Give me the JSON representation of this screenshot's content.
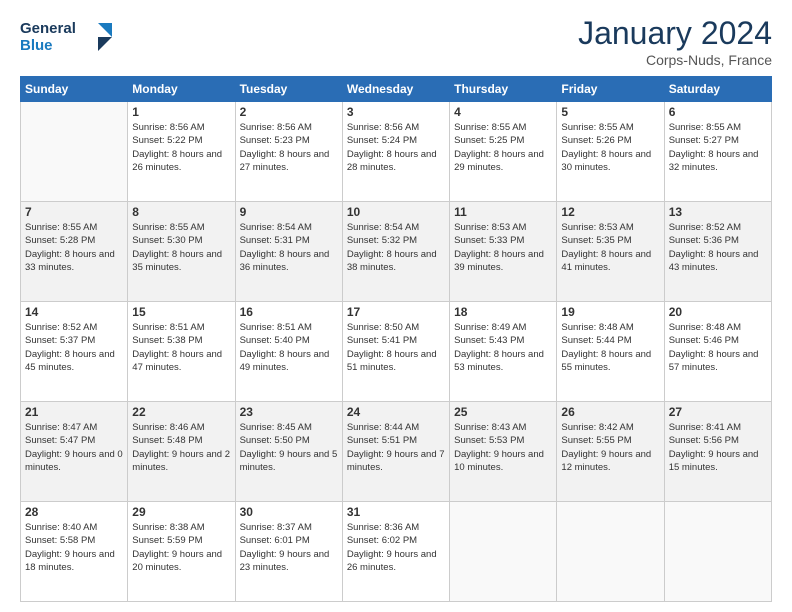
{
  "logo": {
    "line1": "General",
    "line2": "Blue"
  },
  "title": "January 2024",
  "location": "Corps-Nuds, France",
  "weekdays": [
    "Sunday",
    "Monday",
    "Tuesday",
    "Wednesday",
    "Thursday",
    "Friday",
    "Saturday"
  ],
  "weeks": [
    [
      {
        "day": "",
        "sunrise": "",
        "sunset": "",
        "daylight": ""
      },
      {
        "day": "1",
        "sunrise": "Sunrise: 8:56 AM",
        "sunset": "Sunset: 5:22 PM",
        "daylight": "Daylight: 8 hours and 26 minutes."
      },
      {
        "day": "2",
        "sunrise": "Sunrise: 8:56 AM",
        "sunset": "Sunset: 5:23 PM",
        "daylight": "Daylight: 8 hours and 27 minutes."
      },
      {
        "day": "3",
        "sunrise": "Sunrise: 8:56 AM",
        "sunset": "Sunset: 5:24 PM",
        "daylight": "Daylight: 8 hours and 28 minutes."
      },
      {
        "day": "4",
        "sunrise": "Sunrise: 8:55 AM",
        "sunset": "Sunset: 5:25 PM",
        "daylight": "Daylight: 8 hours and 29 minutes."
      },
      {
        "day": "5",
        "sunrise": "Sunrise: 8:55 AM",
        "sunset": "Sunset: 5:26 PM",
        "daylight": "Daylight: 8 hours and 30 minutes."
      },
      {
        "day": "6",
        "sunrise": "Sunrise: 8:55 AM",
        "sunset": "Sunset: 5:27 PM",
        "daylight": "Daylight: 8 hours and 32 minutes."
      }
    ],
    [
      {
        "day": "7",
        "sunrise": "Sunrise: 8:55 AM",
        "sunset": "Sunset: 5:28 PM",
        "daylight": "Daylight: 8 hours and 33 minutes."
      },
      {
        "day": "8",
        "sunrise": "Sunrise: 8:55 AM",
        "sunset": "Sunset: 5:30 PM",
        "daylight": "Daylight: 8 hours and 35 minutes."
      },
      {
        "day": "9",
        "sunrise": "Sunrise: 8:54 AM",
        "sunset": "Sunset: 5:31 PM",
        "daylight": "Daylight: 8 hours and 36 minutes."
      },
      {
        "day": "10",
        "sunrise": "Sunrise: 8:54 AM",
        "sunset": "Sunset: 5:32 PM",
        "daylight": "Daylight: 8 hours and 38 minutes."
      },
      {
        "day": "11",
        "sunrise": "Sunrise: 8:53 AM",
        "sunset": "Sunset: 5:33 PM",
        "daylight": "Daylight: 8 hours and 39 minutes."
      },
      {
        "day": "12",
        "sunrise": "Sunrise: 8:53 AM",
        "sunset": "Sunset: 5:35 PM",
        "daylight": "Daylight: 8 hours and 41 minutes."
      },
      {
        "day": "13",
        "sunrise": "Sunrise: 8:52 AM",
        "sunset": "Sunset: 5:36 PM",
        "daylight": "Daylight: 8 hours and 43 minutes."
      }
    ],
    [
      {
        "day": "14",
        "sunrise": "Sunrise: 8:52 AM",
        "sunset": "Sunset: 5:37 PM",
        "daylight": "Daylight: 8 hours and 45 minutes."
      },
      {
        "day": "15",
        "sunrise": "Sunrise: 8:51 AM",
        "sunset": "Sunset: 5:38 PM",
        "daylight": "Daylight: 8 hours and 47 minutes."
      },
      {
        "day": "16",
        "sunrise": "Sunrise: 8:51 AM",
        "sunset": "Sunset: 5:40 PM",
        "daylight": "Daylight: 8 hours and 49 minutes."
      },
      {
        "day": "17",
        "sunrise": "Sunrise: 8:50 AM",
        "sunset": "Sunset: 5:41 PM",
        "daylight": "Daylight: 8 hours and 51 minutes."
      },
      {
        "day": "18",
        "sunrise": "Sunrise: 8:49 AM",
        "sunset": "Sunset: 5:43 PM",
        "daylight": "Daylight: 8 hours and 53 minutes."
      },
      {
        "day": "19",
        "sunrise": "Sunrise: 8:48 AM",
        "sunset": "Sunset: 5:44 PM",
        "daylight": "Daylight: 8 hours and 55 minutes."
      },
      {
        "day": "20",
        "sunrise": "Sunrise: 8:48 AM",
        "sunset": "Sunset: 5:46 PM",
        "daylight": "Daylight: 8 hours and 57 minutes."
      }
    ],
    [
      {
        "day": "21",
        "sunrise": "Sunrise: 8:47 AM",
        "sunset": "Sunset: 5:47 PM",
        "daylight": "Daylight: 9 hours and 0 minutes."
      },
      {
        "day": "22",
        "sunrise": "Sunrise: 8:46 AM",
        "sunset": "Sunset: 5:48 PM",
        "daylight": "Daylight: 9 hours and 2 minutes."
      },
      {
        "day": "23",
        "sunrise": "Sunrise: 8:45 AM",
        "sunset": "Sunset: 5:50 PM",
        "daylight": "Daylight: 9 hours and 5 minutes."
      },
      {
        "day": "24",
        "sunrise": "Sunrise: 8:44 AM",
        "sunset": "Sunset: 5:51 PM",
        "daylight": "Daylight: 9 hours and 7 minutes."
      },
      {
        "day": "25",
        "sunrise": "Sunrise: 8:43 AM",
        "sunset": "Sunset: 5:53 PM",
        "daylight": "Daylight: 9 hours and 10 minutes."
      },
      {
        "day": "26",
        "sunrise": "Sunrise: 8:42 AM",
        "sunset": "Sunset: 5:55 PM",
        "daylight": "Daylight: 9 hours and 12 minutes."
      },
      {
        "day": "27",
        "sunrise": "Sunrise: 8:41 AM",
        "sunset": "Sunset: 5:56 PM",
        "daylight": "Daylight: 9 hours and 15 minutes."
      }
    ],
    [
      {
        "day": "28",
        "sunrise": "Sunrise: 8:40 AM",
        "sunset": "Sunset: 5:58 PM",
        "daylight": "Daylight: 9 hours and 18 minutes."
      },
      {
        "day": "29",
        "sunrise": "Sunrise: 8:38 AM",
        "sunset": "Sunset: 5:59 PM",
        "daylight": "Daylight: 9 hours and 20 minutes."
      },
      {
        "day": "30",
        "sunrise": "Sunrise: 8:37 AM",
        "sunset": "Sunset: 6:01 PM",
        "daylight": "Daylight: 9 hours and 23 minutes."
      },
      {
        "day": "31",
        "sunrise": "Sunrise: 8:36 AM",
        "sunset": "Sunset: 6:02 PM",
        "daylight": "Daylight: 9 hours and 26 minutes."
      },
      {
        "day": "",
        "sunrise": "",
        "sunset": "",
        "daylight": ""
      },
      {
        "day": "",
        "sunrise": "",
        "sunset": "",
        "daylight": ""
      },
      {
        "day": "",
        "sunrise": "",
        "sunset": "",
        "daylight": ""
      }
    ]
  ]
}
